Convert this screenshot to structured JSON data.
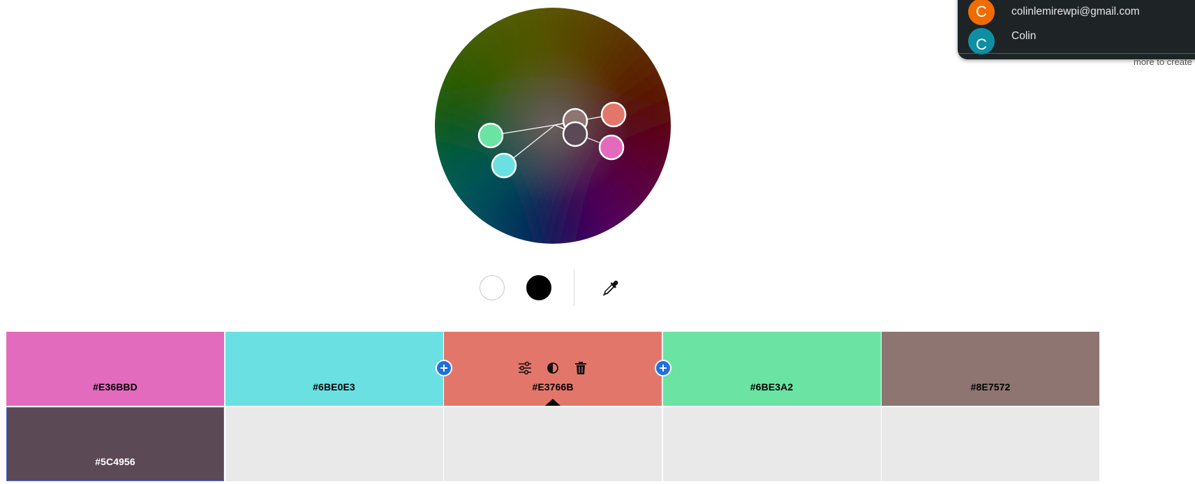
{
  "wheel": {
    "handles": [
      {
        "name": "handle-green",
        "color": "#6BE3A2"
      },
      {
        "name": "handle-cyan",
        "color": "#6BE0E3"
      },
      {
        "name": "handle-brown",
        "color": "#8E7572"
      },
      {
        "name": "handle-dark",
        "color": "#5C4956"
      },
      {
        "name": "handle-red",
        "color": "#E3766B"
      },
      {
        "name": "handle-pink",
        "color": "#E36BBD"
      }
    ]
  },
  "controls": {
    "white": "#FFFFFF",
    "black": "#000000",
    "eyedropper_icon": "eyedropper-icon"
  },
  "palette": {
    "rows": [
      [
        {
          "hex": "#E36BBD",
          "label": "#E36BBD",
          "text_color": "#000000"
        },
        {
          "hex": "#6BE0E3",
          "label": "#6BE0E3",
          "text_color": "#000000"
        },
        {
          "hex": "#E3766B",
          "label": "#E3766B",
          "text_color": "#000000",
          "selected": true
        },
        {
          "hex": "#6BE3A2",
          "label": "#6BE3A2",
          "text_color": "#000000"
        },
        {
          "hex": "#8E7572",
          "label": "#8E7572",
          "text_color": "#000000"
        }
      ],
      [
        {
          "hex": "#5C4956",
          "label": "#5C4956",
          "text_color": "#FFFFFF"
        },
        {
          "hex": "",
          "label": ""
        },
        {
          "hex": "",
          "label": ""
        },
        {
          "hex": "",
          "label": ""
        },
        {
          "hex": "",
          "label": ""
        }
      ]
    ],
    "tool_icons": [
      "sliders-icon",
      "contrast-icon",
      "trash-icon"
    ],
    "add_icon": "plus-icon"
  },
  "account_menu": {
    "accounts": [
      {
        "initial": "C",
        "avatar_color": "#ef6c00",
        "text": "colinlemirewpi@gmail.com"
      },
      {
        "initial": "C",
        "avatar_color": "#0e8fa3",
        "text": "Colin"
      }
    ],
    "helper_text": "more to create b"
  }
}
